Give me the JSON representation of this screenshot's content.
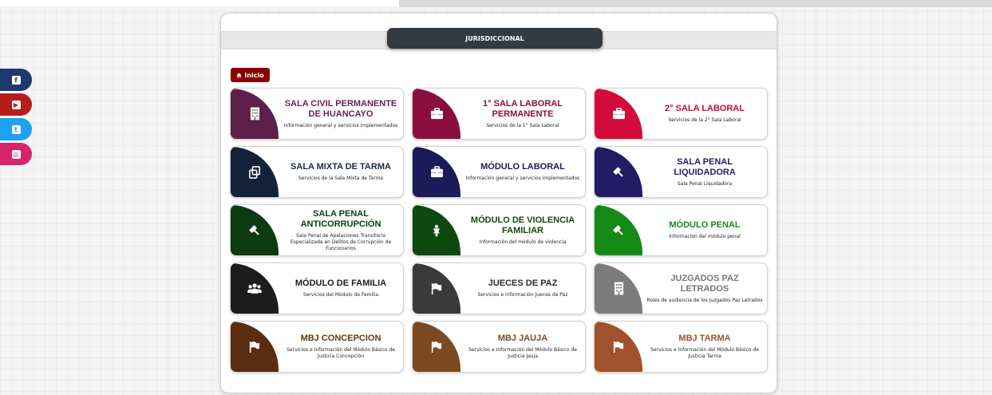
{
  "social": [
    {
      "name": "facebook",
      "color": "#1e3a6d",
      "glyph": "f"
    },
    {
      "name": "youtube",
      "color": "#b71c1c",
      "glyph": "▶"
    },
    {
      "name": "twitter",
      "color": "#1da1f2",
      "glyph": "t"
    },
    {
      "name": "instagram",
      "color": "#d6246e",
      "glyph": "◎"
    }
  ],
  "section": {
    "title": "JURISDICCIONAL"
  },
  "home": {
    "label": "Inicio"
  },
  "cards": [
    {
      "title": "SALA CIVIL PERMANENTE DE HUANCAYO",
      "desc": "Información general y servicios implementados",
      "color": "#5c2048",
      "title_color": "#6b1f4f",
      "icon": "building-icon"
    },
    {
      "title": "1° SALA LABORAL PERMANENTE",
      "desc": "Servicios de la 1° Sala Laboral",
      "color": "#8a0f3f",
      "title_color": "#8a0f3f",
      "icon": "briefcase-icon"
    },
    {
      "title": "2° SALA LABORAL",
      "desc": "Servicios de la 2° Sala Laboral",
      "color": "#d10b3a",
      "title_color": "#c80a3a",
      "icon": "briefcase-icon"
    },
    {
      "title": "SALA MIXTA DE TARMA",
      "desc": "Servicios de la Sala Mixta de Tarma",
      "color": "#132238",
      "title_color": "#1b2a40",
      "icon": "copy-icon"
    },
    {
      "title": "MÓDULO LABORAL",
      "desc": "Información general y servicios implementados",
      "color": "#1c1b59",
      "title_color": "#1c1b59",
      "icon": "briefcase-icon"
    },
    {
      "title": "SALA PENAL LIQUIDADORA",
      "desc": "Sala Penal Liquidadora",
      "color": "#231b63",
      "title_color": "#231b63",
      "icon": "gavel-icon"
    },
    {
      "title": "SALA PENAL ANTICORRUPCIÓN",
      "desc": "Sala Penal de Apelaciones Transitoria Especializada en Delitos de Corrupción de Funcionarios",
      "color": "#0c3b12",
      "title_color": "#0c3b12",
      "icon": "gavel-icon"
    },
    {
      "title": "MÓDULO DE VIOLENCIA FAMILIAR",
      "desc": "Información del módulo de violencia",
      "color": "#0e4a10",
      "title_color": "#0e4a10",
      "icon": "child-icon"
    },
    {
      "title": "MÓDULO PENAL",
      "desc": "Información del módulo penal",
      "color": "#168a16",
      "title_color": "#158a15",
      "icon": "gavel-icon"
    },
    {
      "title": "MÓDULO DE FAMILIA",
      "desc": "Servicios del Módulo de Familia",
      "color": "#1d1d1d",
      "title_color": "#1d1d1d",
      "icon": "users-icon"
    },
    {
      "title": "JUECES DE PAZ",
      "desc": "Servicios e información Jueces de Paz",
      "color": "#3a3a3a",
      "title_color": "#2a2a2a",
      "icon": "flag-icon"
    },
    {
      "title": "JUZGADOS PAZ LETRADOS",
      "desc": "Roles de audiencia de los Juzgados Paz Letrados",
      "color": "#7b7b7b",
      "title_color": "#777777",
      "icon": "building-icon"
    },
    {
      "title": "MBJ CONCEPCION",
      "desc": "Servicios e Información del Módulo Básico de Justicia Concepción",
      "color": "#5a2d10",
      "title_color": "#6a3512",
      "icon": "flag-icon"
    },
    {
      "title": "MBJ JAUJA",
      "desc": "Servicios e Información del Módulo Básico de Justicia Jauja",
      "color": "#7b4a21",
      "title_color": "#7b4a21",
      "icon": "flag-icon"
    },
    {
      "title": "MBJ TARMA",
      "desc": "Servicios e Información del Módulo Básico de Justicia Tarma",
      "color": "#a0522d",
      "title_color": "#a0522d",
      "icon": "flag-icon"
    }
  ]
}
